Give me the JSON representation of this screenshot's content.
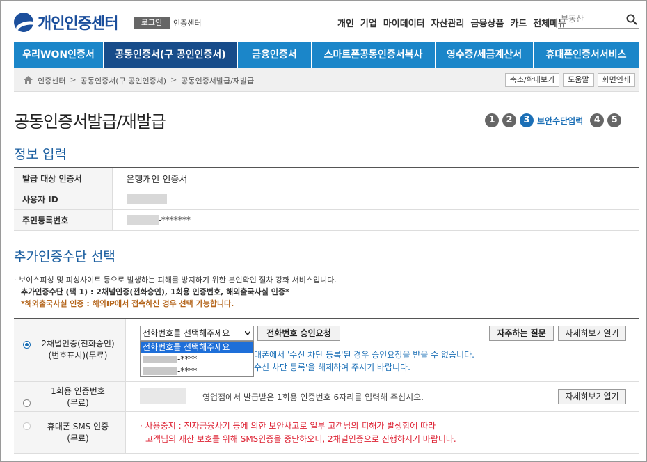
{
  "header": {
    "logo_text": "개인인증센터",
    "login_label": "로그인",
    "center_label": "인증센터",
    "top_menu": [
      "개인",
      "기업",
      "마이데이터",
      "자산관리",
      "금융상품",
      "카드",
      "전체메뉴"
    ],
    "search_placeholder": "부동산"
  },
  "nav": {
    "items": [
      {
        "label": "우리WON인증서"
      },
      {
        "label": "공동인증서(구 공인인증서)"
      },
      {
        "label": "금융인증서"
      },
      {
        "label": "스마트폰공동인증서복사"
      },
      {
        "label": "영수증/세금계산서"
      },
      {
        "label": "휴대폰인증서서비스"
      }
    ]
  },
  "breadcrumb": {
    "items": [
      "인증센터",
      "공동인증서(구 공인인증서)",
      "공동인증서발급/재발급"
    ],
    "separator": ">",
    "buttons": [
      "축소/확대보기",
      "도움말",
      "화면인쇄"
    ]
  },
  "page": {
    "title": "공동인증서발급/재발급",
    "steps": [
      "1",
      "2",
      "3",
      "4",
      "5"
    ],
    "active_step_label": "보안수단입력"
  },
  "info_section": {
    "title": "정보 입력",
    "rows": [
      {
        "label": "발급 대상 인증서",
        "value": "은행개인 인증서"
      },
      {
        "label": "사용자 ID",
        "value": ""
      },
      {
        "label": "주민등록번호",
        "value": "-*******"
      }
    ]
  },
  "auth_section": {
    "title": "추가인증수단 선택",
    "desc_line1": "· 보이스피싱 및 피싱사이트 등으로 발생하는 피해를 방지하기 위한 본인확인 절차 강화 서비스입니다.",
    "desc_line2": "추가인증수단 (택 1) : 2채널인증(전화승인), 1회용 인증번호, 해외출국사실 인증*",
    "desc_line3": "*해외출국사실 인증 : 해외IP에서 접속하신 경우 선택 가능합니다.",
    "two_channel": {
      "label_line1": "2채널인증(전화승인)",
      "label_line2": "(번호표시)(무료)",
      "select_value": "전화번호를 선택해주세요",
      "dropdown_options": [
        "전화번호를 선택해주세요",
        "-****",
        "-****"
      ],
      "request_button": "전화번호 승인요청",
      "faq_button": "자주하는 질문",
      "detail_button": "자세히보기열기",
      "notice_line1": "대폰에서 '수신 차단 등록'된 경우 승인요청을 받을 수 없습니다.",
      "notice_line2": "수신 차단 등록'을 해제하여 주시기 바랍니다."
    },
    "otp": {
      "label_line1": "1회용 인증번호",
      "label_line2": "(무료)",
      "hint": "영업점에서 발급받은 1회용 인증번호 6자리를 입력해 주십시오.",
      "detail_button": "자세히보기열기"
    },
    "sms": {
      "label_line1": "휴대폰 SMS 인증",
      "label_line2": "(무료)",
      "notice_line1": "· 사용중지 : 전자금융사기 등에 의한 보안사고로 일부 고객님의 피해가 발생함에 따라",
      "notice_line2": "고객님의 재산 보호를 위해 SMS인증을 중단하오니, 2채널인증으로 진행하시기 바랍니다."
    }
  },
  "colors": {
    "brand": "#1c4f9c",
    "nav": "#1b86c9",
    "nav_active": "#174c8a",
    "notice_blue": "#1b6fb6",
    "notice_red": "#dd2233",
    "warn_orange": "#b4651b"
  }
}
